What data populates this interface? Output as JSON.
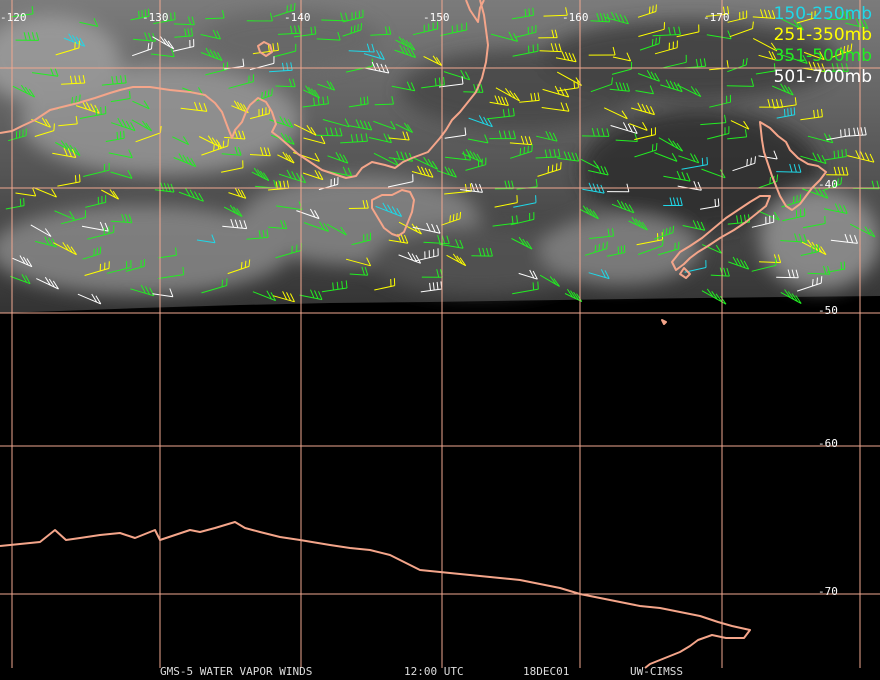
{
  "legend": {
    "items": [
      {
        "label": "150-250mb",
        "color": "#1fd8e8"
      },
      {
        "label": "251-350mb",
        "color": "#ffff00"
      },
      {
        "label": "351-500mb",
        "color": "#22ee22"
      },
      {
        "label": "501-700mb",
        "color": "#ffffff"
      }
    ]
  },
  "longitude_labels": [
    "-120",
    "-130",
    "-140",
    "-150",
    "-160",
    "-170"
  ],
  "latitude_labels": [
    "-40",
    "-50",
    "-60",
    "-70"
  ],
  "footer": {
    "satellite": "GMS-5 WATER VAPOR WINDS",
    "time": "12:00 UTC",
    "date": "18DEC01",
    "credit": "UW-CIMSS"
  },
  "colors": {
    "grid": "#f0a890",
    "coast": "#f4a58a",
    "background": "#000000"
  }
}
